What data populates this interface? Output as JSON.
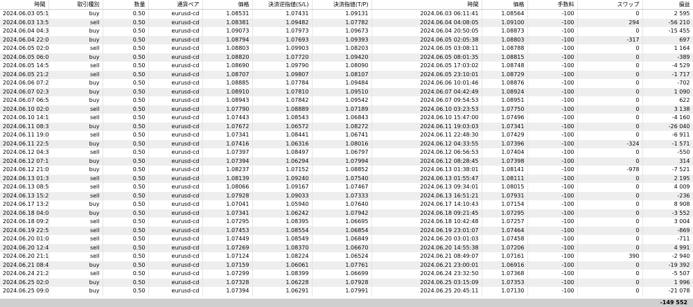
{
  "headers": [
    "時間",
    "取引種別",
    "数量",
    "通貨ペア",
    "価格",
    "決済逆指値(S/L)",
    "決済指値(T/P)",
    "時間",
    "価格",
    "手数料",
    "スワップ",
    "損益"
  ],
  "rows": [
    [
      "2024.06.03 05:13:30",
      "buy",
      "0.50",
      "eurusd-cd",
      "1.08531",
      "1.07431",
      "1.09131",
      "2024.06.03 06:11:41",
      "1.08564",
      "-100",
      "0",
      "2 595"
    ],
    [
      "2024.06.03 13:54:46",
      "sell",
      "0.50",
      "eurusd-cd",
      "1.08381",
      "1.09482",
      "1.07782",
      "2024.06.04 04:08:05",
      "1.09100",
      "-100",
      "294",
      "-56 210"
    ],
    [
      "2024.06.04 04:37:02",
      "buy",
      "0.50",
      "eurusd-cd",
      "1.09073",
      "1.07973",
      "1.09673",
      "2024.06.04 20:50:05",
      "1.08873",
      "-100",
      "0",
      "-15 455"
    ],
    [
      "2024.06.04 22:04:04",
      "buy",
      "0.50",
      "eurusd-cd",
      "1.08794",
      "1.07693",
      "1.09393",
      "2024.06.05 02:05:38",
      "1.08803",
      "-100",
      "-317",
      "697"
    ],
    [
      "2024.06.05 02:05:39",
      "sell",
      "0.50",
      "eurusd-cd",
      "1.08803",
      "1.09903",
      "1.08203",
      "2024.06.05 03:08:11",
      "1.08788",
      "-100",
      "0",
      "1 164"
    ],
    [
      "2024.06.05 06:04:42",
      "buy",
      "0.50",
      "eurusd-cd",
      "1.08820",
      "1.07720",
      "1.09420",
      "2024.06.05 08:01:35",
      "1.08815",
      "-100",
      "0",
      "-389"
    ],
    [
      "2024.06.05 14:56:32",
      "sell",
      "0.50",
      "eurusd-cd",
      "1.08690",
      "1.09790",
      "1.08090",
      "2024.06.05 17:03:02",
      "1.08748",
      "-100",
      "0",
      "-4 529"
    ],
    [
      "2024.06.05 21:29:50",
      "sell",
      "0.50",
      "eurusd-cd",
      "1.08707",
      "1.09807",
      "1.08107",
      "2024.06.05 23:10:01",
      "1.08729",
      "-100",
      "0",
      "-1 717"
    ],
    [
      "2024.06.06 07:20:12",
      "buy",
      "0.50",
      "eurusd-cd",
      "1.08885",
      "1.07784",
      "1.09484",
      "2024.06.06 10:01:46",
      "1.08876",
      "-100",
      "0",
      "-702"
    ],
    [
      "2024.06.07 02:37:30",
      "buy",
      "0.50",
      "eurusd-cd",
      "1.08910",
      "1.07810",
      "1.09510",
      "2024.06.07 04:42:49",
      "1.08924",
      "-100",
      "0",
      "1 090"
    ],
    [
      "2024.06.07 06:57:09",
      "buy",
      "0.50",
      "eurusd-cd",
      "1.08943",
      "1.07842",
      "1.09542",
      "2024.06.07 09:54:53",
      "1.08951",
      "-100",
      "0",
      "622"
    ],
    [
      "2024.06.10 02:05:13",
      "sell",
      "0.50",
      "eurusd-cd",
      "1.07790",
      "1.08889",
      "1.07189",
      "2024.06.10 03:23:53",
      "1.07750",
      "-100",
      "0",
      "3 138"
    ],
    [
      "2024.06.10 14:16:21",
      "sell",
      "0.50",
      "eurusd-cd",
      "1.07443",
      "1.08543",
      "1.06843",
      "2024.06.10 15:47:00",
      "1.07496",
      "-100",
      "0",
      "-4 160"
    ],
    [
      "2024.06.11 08:34:21",
      "buy",
      "0.50",
      "eurusd-cd",
      "1.07672",
      "1.06572",
      "1.08272",
      "2024.06.11 19:03:03",
      "1.07341",
      "-100",
      "0",
      "-26 040"
    ],
    [
      "2024.06.11 19:03:03",
      "sell",
      "0.50",
      "eurusd-cd",
      "1.07341",
      "1.08441",
      "1.06741",
      "2024.06.11 22:48:30",
      "1.07429",
      "-100",
      "0",
      "-6 911"
    ],
    [
      "2024.06.11 22:58:10",
      "buy",
      "0.50",
      "eurusd-cd",
      "1.07416",
      "1.06316",
      "1.08016",
      "2024.06.12 04:33:55",
      "1.07396",
      "-100",
      "-324",
      "-1 571"
    ],
    [
      "2024.06.12 04:34:00",
      "sell",
      "0.50",
      "eurusd-cd",
      "1.07397",
      "1.08497",
      "1.06797",
      "2024.06.12 06:56:53",
      "1.07404",
      "-100",
      "0",
      "-550"
    ],
    [
      "2024.06.12 07:19:05",
      "buy",
      "0.50",
      "eurusd-cd",
      "1.07394",
      "1.06294",
      "1.07994",
      "2024.06.12 08:28:45",
      "1.07398",
      "-100",
      "0",
      "314"
    ],
    [
      "2024.06.12 21:00:22",
      "buy",
      "0.50",
      "eurusd-cd",
      "1.08237",
      "1.07152",
      "1.08852",
      "2024.06.13 01:38:01",
      "1.08141",
      "-100",
      "-978",
      "-7 521"
    ],
    [
      "2024.06.13 01:38:03",
      "sell",
      "0.50",
      "eurusd-cd",
      "1.08139",
      "1.09240",
      "1.07540",
      "2024.06.13 01:55:47",
      "1.08111",
      "-100",
      "0",
      "2 195"
    ],
    [
      "2024.06.13 08:58:33",
      "sell",
      "0.50",
      "eurusd-cd",
      "1.08066",
      "1.09167",
      "1.07467",
      "2024.06.13 09:34:01",
      "1.08015",
      "-100",
      "0",
      "4 009"
    ],
    [
      "2024.06.13 15:22:55",
      "sell",
      "0.50",
      "eurusd-cd",
      "1.07928",
      "1.09033",
      "1.07333",
      "2024.06.13 16:51:21",
      "1.07931",
      "-100",
      "0",
      "-236"
    ],
    [
      "2024.06.17 13:21:55",
      "buy",
      "0.50",
      "eurusd-cd",
      "1.07041",
      "1.05940",
      "1.07640",
      "2024.06.17 14:10:43",
      "1.07154",
      "-100",
      "0",
      "8 908"
    ],
    [
      "2024.06.18 04:04:10",
      "buy",
      "0.50",
      "eurusd-cd",
      "1.07341",
      "1.06242",
      "1.07942",
      "2024.06.18 09:21:45",
      "1.07295",
      "-100",
      "0",
      "-3 552"
    ],
    [
      "2024.06.18 09:21:46",
      "sell",
      "0.50",
      "eurusd-cd",
      "1.07295",
      "1.08395",
      "1.06695",
      "2024.06.18 10:42:48",
      "1.07257",
      "-100",
      "0",
      "3 004"
    ],
    [
      "2024.06.19 22:53:21",
      "sell",
      "0.50",
      "eurusd-cd",
      "1.07453",
      "1.08554",
      "1.06854",
      "2024.06.19 23:01:07",
      "1.07464",
      "-100",
      "0",
      "-869"
    ],
    [
      "2024.06.20 01:00:01",
      "sell",
      "0.50",
      "eurusd-cd",
      "1.07449",
      "1.08549",
      "1.06849",
      "2024.06.20 03:01:03",
      "1.07458",
      "-100",
      "0",
      "-711"
    ],
    [
      "2024.06.20 12:47:25",
      "sell",
      "0.50",
      "eurusd-cd",
      "1.07269",
      "1.08370",
      "1.06670",
      "2024.06.20 14:55:38",
      "1.07206",
      "-100",
      "0",
      "4 991"
    ],
    [
      "2024.06.20 21:17:46",
      "sell",
      "0.50",
      "eurusd-cd",
      "1.07124",
      "1.08224",
      "1.06524",
      "2024.06.21 08:49:07",
      "1.07161",
      "-100",
      "390",
      "-2 940"
    ],
    [
      "2024.06.21 08:49:08",
      "buy",
      "0.50",
      "eurusd-cd",
      "1.07159",
      "1.06061",
      "1.07761",
      "2024.06.21 23:00:01",
      "1.06916",
      "-100",
      "0",
      "-19 392"
    ],
    [
      "2024.06.24 21:22:04",
      "sell",
      "0.50",
      "eurusd-cd",
      "1.07299",
      "1.08399",
      "1.06699",
      "2024.06.24 23:32:50",
      "1.07368",
      "-100",
      "0",
      "-5 507"
    ],
    [
      "2024.06.25 02:00:37",
      "buy",
      "0.50",
      "eurusd-cd",
      "1.07328",
      "1.06228",
      "1.07928",
      "2024.06.25 03:15:09",
      "1.07353",
      "-100",
      "0",
      "1 996"
    ],
    [
      "2024.06.25 09:03:36",
      "buy",
      "0.50",
      "eurusd-cd",
      "1.07394",
      "1.06291",
      "1.07991",
      "2024.06.25 20:45:11",
      "1.07130",
      "-100",
      "0",
      "-21 078"
    ]
  ],
  "total": "-149 552"
}
